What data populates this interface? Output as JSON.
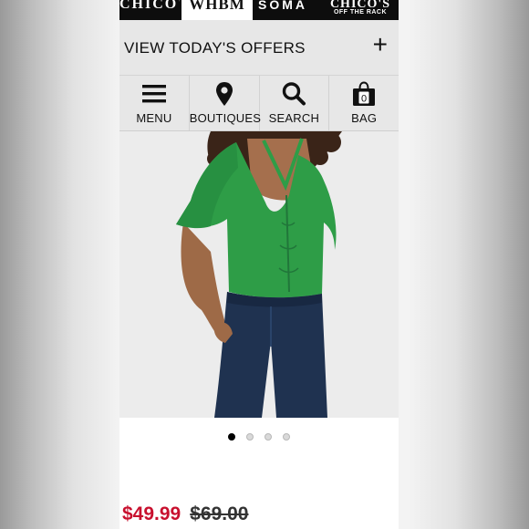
{
  "brands": [
    {
      "name": "CHICO'S"
    },
    {
      "name": "WHBM"
    },
    {
      "name": "SOMA"
    },
    {
      "name": "CHICO'S",
      "sub": "OFF THE RACK"
    }
  ],
  "offers": {
    "label": "VIEW TODAY'S OFFERS",
    "expand_symbol": "+"
  },
  "nav": {
    "menu": {
      "label": "MENU",
      "icon": "hamburger-icon"
    },
    "boutiques": {
      "label": "BOUTIQUES",
      "icon": "location-pin-icon"
    },
    "search": {
      "label": "SEARCH",
      "icon": "search-icon"
    },
    "bag": {
      "label": "BAG",
      "icon": "shopping-bag-icon",
      "count": "0"
    }
  },
  "product": {
    "image_alt": "",
    "image_dots": {
      "total": 4,
      "active": 0
    },
    "price_sale": "$49.99",
    "price_original": "$69.00"
  },
  "colors": {
    "sale_price": "#c8102e",
    "top_green": "#2e9d47",
    "jeans_blue": "#1f3250"
  }
}
